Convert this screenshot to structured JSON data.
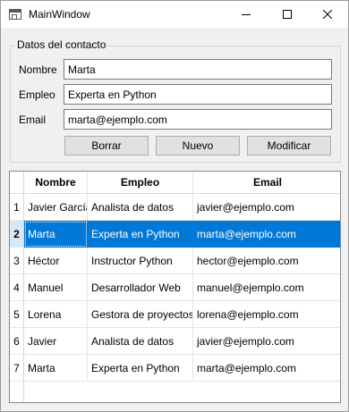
{
  "window": {
    "title": "MainWindow"
  },
  "contact_group": {
    "title": "Datos del contacto",
    "fields": [
      {
        "label": "Nombre",
        "value": "Marta"
      },
      {
        "label": "Empleo",
        "value": "Experta en Python"
      },
      {
        "label": "Email",
        "value": "marta@ejemplo.com"
      }
    ],
    "buttons": {
      "delete": "Borrar",
      "new": "Nuevo",
      "modify": "Modificar"
    }
  },
  "table": {
    "headers": [
      "Nombre",
      "Empleo",
      "Email"
    ],
    "selected_row": 2,
    "rows": [
      {
        "num": "1",
        "cells": [
          "Javier García",
          "Analista de datos",
          "javier@ejemplo.com"
        ]
      },
      {
        "num": "2",
        "cells": [
          "Marta",
          "Experta en Python",
          "marta@ejemplo.com"
        ]
      },
      {
        "num": "3",
        "cells": [
          "Héctor",
          "Instructor Python",
          "hector@ejemplo.com"
        ]
      },
      {
        "num": "4",
        "cells": [
          "Manuel",
          "Desarrollador Web",
          "manuel@ejemplo.com"
        ]
      },
      {
        "num": "5",
        "cells": [
          "Lorena",
          "Gestora de proyectos",
          "lorena@ejemplo.com"
        ]
      },
      {
        "num": "6",
        "cells": [
          "Javier",
          "Analista de datos",
          "javier@ejemplo.com"
        ]
      },
      {
        "num": "7",
        "cells": [
          "Marta",
          "Experta en Python",
          "marta@ejemplo.com"
        ]
      }
    ]
  },
  "colors": {
    "selection": "#0078d7",
    "window_bg": "#f0f0f0"
  }
}
